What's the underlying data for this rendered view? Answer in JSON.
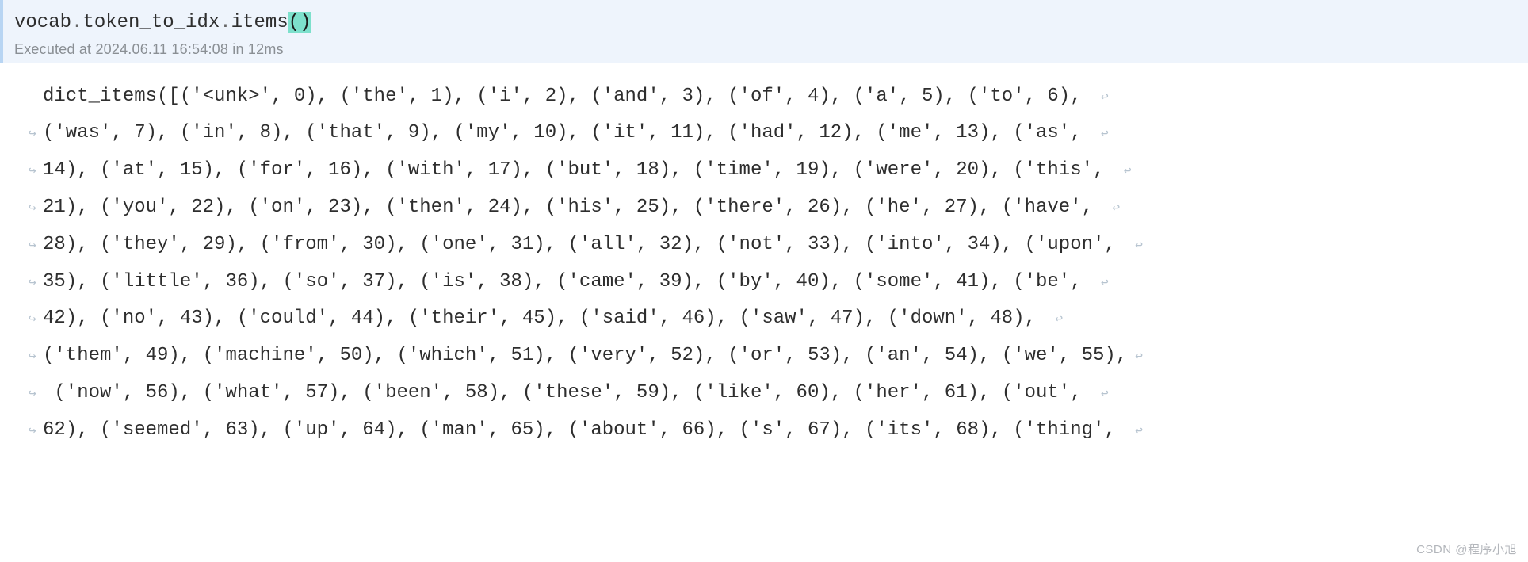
{
  "cell": {
    "code_prefix": "vocab",
    "code_mid1": "token_to_idx",
    "code_mid2": "items",
    "parens": "()",
    "exec_info": "Executed at 2024.06.11 16:54:08 in 12ms"
  },
  "output": {
    "lines": [
      {
        "wl": "",
        "text": "dict_items([('<unk>', 0), ('the', 1), ('i', 2), ('and', 3), ('of', 4), ('a', 5), ('to', 6), ",
        "wr": "↩"
      },
      {
        "wl": "↪",
        "text": "('was', 7), ('in', 8), ('that', 9), ('my', 10), ('it', 11), ('had', 12), ('me', 13), ('as', ",
        "wr": "↩"
      },
      {
        "wl": "↪",
        "text": "14), ('at', 15), ('for', 16), ('with', 17), ('but', 18), ('time', 19), ('were', 20), ('this', ",
        "wr": "↩"
      },
      {
        "wl": "↪",
        "text": "21), ('you', 22), ('on', 23), ('then', 24), ('his', 25), ('there', 26), ('he', 27), ('have', ",
        "wr": "↩"
      },
      {
        "wl": "↪",
        "text": "28), ('they', 29), ('from', 30), ('one', 31), ('all', 32), ('not', 33), ('into', 34), ('upon', ",
        "wr": "↩"
      },
      {
        "wl": "↪",
        "text": "35), ('little', 36), ('so', 37), ('is', 38), ('came', 39), ('by', 40), ('some', 41), ('be', ",
        "wr": "↩"
      },
      {
        "wl": "↪",
        "text": "42), ('no', 43), ('could', 44), ('their', 45), ('said', 46), ('saw', 47), ('down', 48), ",
        "wr": "↩"
      },
      {
        "wl": "↪",
        "text": "('them', 49), ('machine', 50), ('which', 51), ('very', 52), ('or', 53), ('an', 54), ('we', 55),",
        "wr": "↩"
      },
      {
        "wl": "↪",
        "text": " ('now', 56), ('what', 57), ('been', 58), ('these', 59), ('like', 60), ('her', 61), ('out', ",
        "wr": "↩"
      },
      {
        "wl": "↪",
        "text": "62), ('seemed', 63), ('up', 64), ('man', 65), ('about', 66), ('s', 67), ('its', 68), ('thing', ",
        "wr": "↩"
      }
    ]
  },
  "watermark": "CSDN @程序小旭"
}
